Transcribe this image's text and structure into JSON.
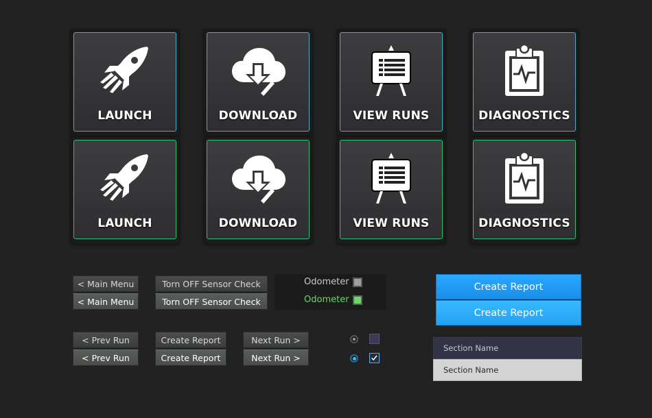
{
  "tiles_row1": [
    {
      "label": "LAUNCH",
      "icon": "rocket-icon"
    },
    {
      "label": "DOWNLOAD",
      "icon": "cloud-download-icon"
    },
    {
      "label": "VIEW RUNS",
      "icon": "easel-chart-icon"
    },
    {
      "label": "DIAGNOSTICS",
      "icon": "clipboard-heartbeat-icon"
    }
  ],
  "tiles_row2": [
    {
      "label": "LAUNCH",
      "icon": "rocket-icon"
    },
    {
      "label": "DOWNLOAD",
      "icon": "cloud-download-icon"
    },
    {
      "label": "VIEW RUNS",
      "icon": "easel-chart-icon"
    },
    {
      "label": "DIAGNOSTICS",
      "icon": "clipboard-heartbeat-icon"
    }
  ],
  "colors": {
    "row1_border": "#3fb0c8",
    "row2_border": "#2fbf75",
    "create_blue": "#1e9df0",
    "odometer_active": "#6fd36f"
  },
  "buttons": {
    "main_menu": "<  Main Menu",
    "main_menu_pressed": "<  Main Menu",
    "sensor_check": "Torn OFF Sensor Check",
    "sensor_check_pressed": "Torn OFF Sensor Check",
    "prev_run": "<  Prev Run",
    "prev_run_pressed": "<  Prev Run",
    "create_report_small": "Create Report",
    "create_report_small_pressed": "Create Report",
    "next_run": "Next Run >",
    "next_run_pressed": "Next Run >"
  },
  "odometer": {
    "label": "Odometer",
    "label_active": "Odometer"
  },
  "create_report": {
    "label": "Create Report",
    "label_hover": "Create Report"
  },
  "sections": {
    "dark": "Section Name",
    "light": "Section Name"
  }
}
